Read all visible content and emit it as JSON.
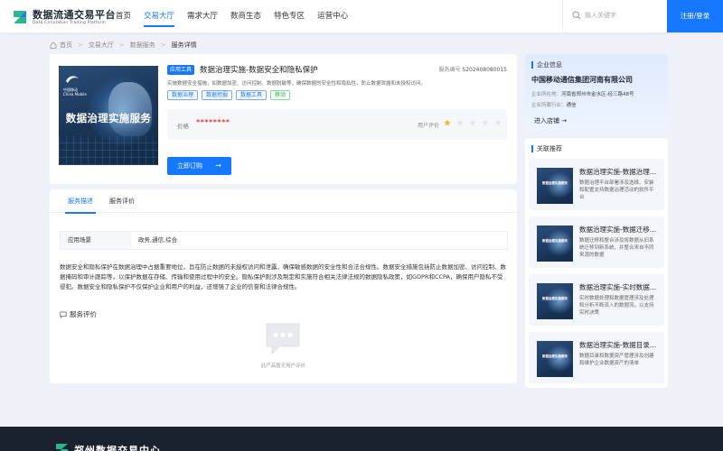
{
  "header": {
    "brand_title": "数据流通交易平台",
    "brand_sub": "Data Circulation Trading Platform",
    "nav": [
      "首页",
      "交易大厅",
      "需求大厅",
      "数商生态",
      "特色专区",
      "运营中心"
    ],
    "active_nav": "交易大厅",
    "search_placeholder": "输入关键字",
    "login_label": "注册/登录"
  },
  "breadcrumb": {
    "items": [
      "首页",
      "交易大厅",
      "数据服务",
      "服务详情"
    ]
  },
  "product": {
    "cover_brand": "中国移动",
    "cover_brand_en": "China Mobile",
    "cover_title": "数据治理实施服务",
    "type_tag": "应用工具",
    "title": "数据治理实施-数据安全和隐私保护",
    "service_no_label": "服务编号",
    "service_no": "S202408080015",
    "desc": "实施数据安全措施，如数据加密、访问控制、数据脱敏等，确保数据的安全性和隐私性，防止数据泄露和未授权访问。",
    "tags": [
      "数据治理",
      "数据挖掘",
      "数据工具",
      "移动"
    ],
    "price_label": "价格",
    "price": "********",
    "rating_label": "用户评价",
    "rating": 1,
    "rating_max": 5,
    "order_label": "立即订购",
    "order_arrow": "→"
  },
  "detail": {
    "tabs": [
      "服务描述",
      "服务评价"
    ],
    "active_tab": 0,
    "scene_label": "应用场景",
    "scene_value": "政务,通信,综合",
    "text": "数据安全和隐私保护在数据治理中占据重要地位，旨在防止数据的未授权访问和泄露，确保敏感数据的安全性和合法合规性。数据安全措施包括防止数据加密、访问控制、数据掩码和审计跟踪等，以保护数据在存储、传输和使用过程中的安全。隐私保护则涉及制定和实施符合相关法律法规的数据隐私政策，如GDPR和CCPA，确保用户隐私不受侵犯。数据安全和隐私保护不仅保护企业和用户的利益，还增强了企业的信誉和法律合规性。",
    "review_title": "服务评价",
    "empty_text": "此产品暂无用户评价"
  },
  "company": {
    "section_title": "企业信息",
    "name": "中国移动通信集团河南有限公司",
    "address_label": "企业所在地：",
    "address": "河南省郑州市金水区-经三路48号",
    "industry_label": "企业所属行业：",
    "industry": "通信",
    "enter_label": "进入店铺",
    "enter_arrow": "→"
  },
  "recommend": {
    "section_title": "关联推荐",
    "thumb_text": "数据治理实施服务",
    "items": [
      {
        "title": "数据治理实施-数据治理平台",
        "desc": "数据治理平台部署涉及选择、安装和配置支持数据治理活动的软件平台"
      },
      {
        "title": "数据治理实施-数据迁移与整合",
        "desc": "数据迁移和整合涉及将数据从旧系统迁移到新系统，并整合来自不同来源的数据"
      },
      {
        "title": "数据治理实施-实时数据管理",
        "desc": "实时数据处理和数据管理涉及处理和分析不断流入的数据流，以支持实时决策"
      },
      {
        "title": "数据治理实施-数据目录和元数据管理",
        "desc": "数据目录和数据资产管理涉及创建和维护企业数据资产的清单"
      }
    ]
  },
  "footer": {
    "title": "郑州数据交易中心"
  },
  "colors": {
    "accent": "#1677ff",
    "price": "#e23a3a",
    "star_on": "#f5b72a",
    "star_off": "#e3e6eb",
    "footer_bg": "#1a2230"
  }
}
